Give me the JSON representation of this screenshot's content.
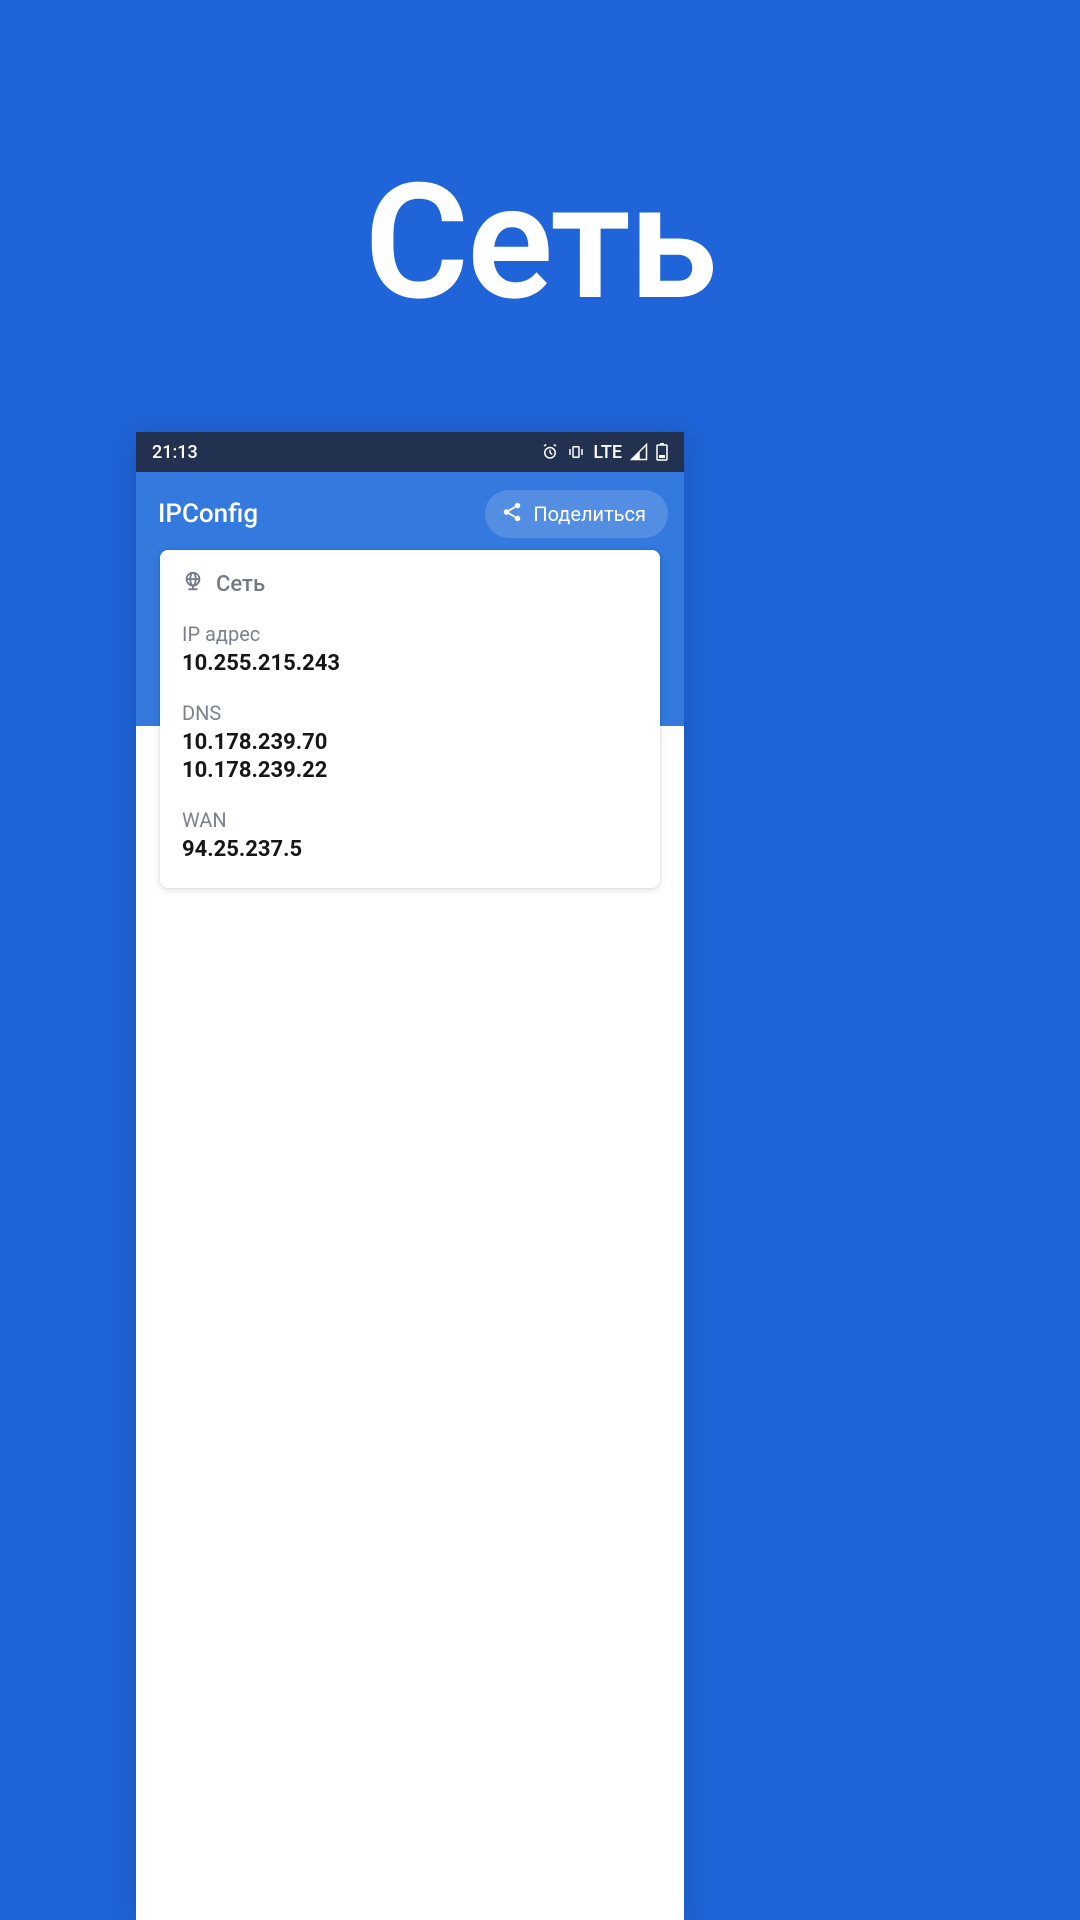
{
  "page": {
    "title": "Сеть"
  },
  "status_bar": {
    "time": "21:13",
    "connection": "LTE"
  },
  "app": {
    "title": "IPConfig",
    "share_label": "Поделиться"
  },
  "card": {
    "title": "Сеть",
    "fields": [
      {
        "label": "IP адрес",
        "value": "10.255.215.243"
      },
      {
        "label": "DNS",
        "value": "10.178.239.70\n10.178.239.22"
      },
      {
        "label": "WAN",
        "value": "94.25.237.5"
      }
    ]
  }
}
